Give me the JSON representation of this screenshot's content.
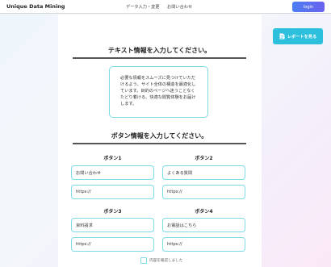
{
  "header": {
    "logo": "Unique Data Mining",
    "nav": [
      "データ入力・変更",
      "お問い合わせ"
    ],
    "login": "login"
  },
  "report_button": {
    "label": "レポートを見る",
    "icon": "document-icon"
  },
  "text_section": {
    "title": "テキスト情報を入力してください。",
    "note_lines": [
      "必要な情報をスムーズに見つけていただ",
      "けるよう、サイト全体の構造を最適化し",
      "ています。目的のページへ迷うことなく",
      "たどり着ける、快適な閲覧体験をお届け",
      "します。"
    ]
  },
  "button_section": {
    "title": "ボタン情報を入力してください。",
    "buttons": [
      {
        "heading": "ボタン1",
        "label": "お問い合わせ",
        "url": "https://"
      },
      {
        "heading": "ボタン2",
        "label": "よくある質問",
        "url": "https://"
      },
      {
        "heading": "ボタン3",
        "label": "資料請求",
        "url": "https://"
      },
      {
        "heading": "ボタン4",
        "label": "お電話はこちら",
        "url": "https://"
      }
    ]
  },
  "confirm": {
    "label": "内容を確認しました"
  },
  "colors": {
    "accent": "#2cc0dc",
    "login": "#5b70f0",
    "field_border": "#7ddce8"
  }
}
